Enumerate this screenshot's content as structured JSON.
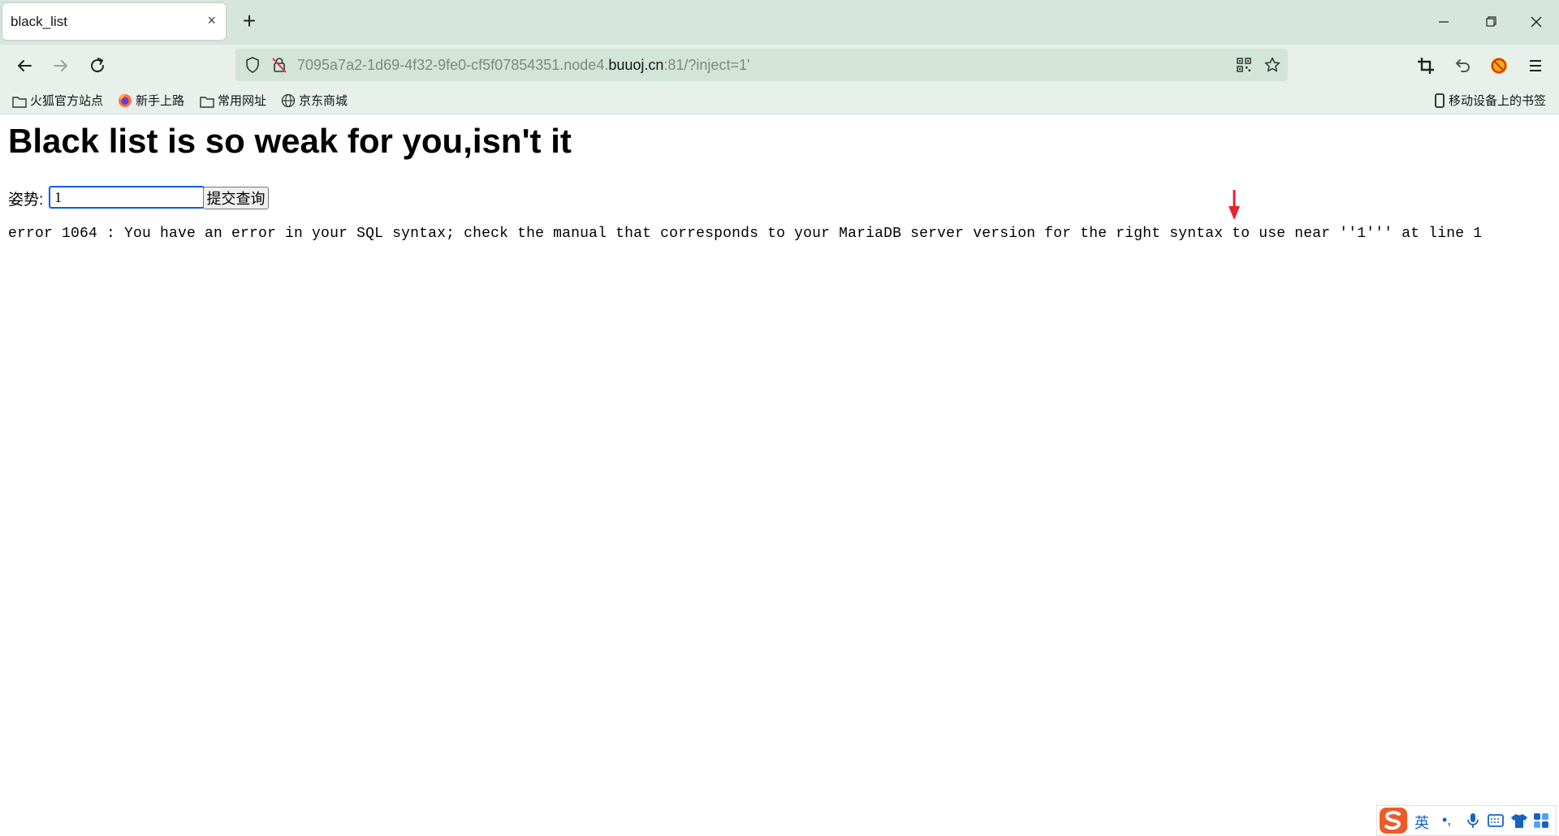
{
  "browser": {
    "tab_title": "black_list",
    "tab_close": "×",
    "new_tab": "+",
    "url": {
      "prefix": "7095a7a2-1d69-4f32-9fe0-cf5f07854351.node4.",
      "host": "buuoj.cn",
      "suffix": ":81/?inject=1'"
    },
    "bookmarks": [
      {
        "label": "火狐官方站点",
        "icon": "folder-icon"
      },
      {
        "label": "新手上路",
        "icon": "firefox-icon"
      },
      {
        "label": "常用网址",
        "icon": "folder-icon"
      },
      {
        "label": "京东商城",
        "icon": "globe-icon"
      }
    ],
    "mobile_bookmarks": "移动设备上的书签"
  },
  "page": {
    "title": "Black list is so weak for you,isn't it",
    "form": {
      "label": "姿势:",
      "input_value": "1",
      "submit_label": "提交查询"
    },
    "error_message": "error 1064 : You have an error in your SQL syntax; check the manual that corresponds to your MariaDB server version for the right syntax to use near ''1''' at line 1"
  },
  "ime": {
    "mode": "英",
    "punct": "•,"
  },
  "colors": {
    "tabstrip": "#d6e6dc",
    "toolbar": "#e7f0ea",
    "urlbar": "#d3e4d9",
    "focus": "#0060df",
    "annotation_arrow": "#e8212b"
  }
}
